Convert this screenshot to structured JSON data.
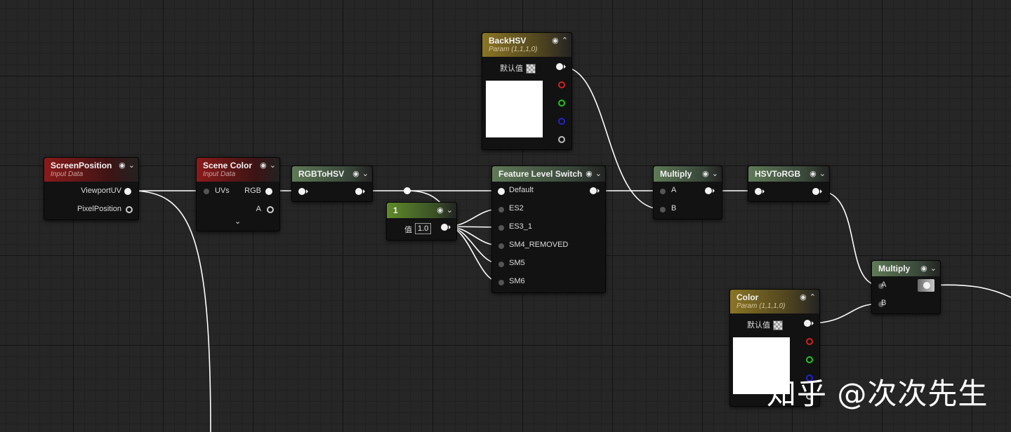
{
  "nodes": {
    "screen_position": {
      "title": "ScreenPosition",
      "subtitle": "Input Data",
      "outputs": [
        "ViewportUV",
        "PixelPosition"
      ]
    },
    "scene_color": {
      "title": "Scene Color",
      "subtitle": "Input Data",
      "input": "UVs",
      "outputs": [
        "RGB",
        "A"
      ],
      "expand_glyph": "⌄"
    },
    "rgb_to_hsv": {
      "title": "RGBToHSV"
    },
    "constant": {
      "title": "1",
      "value_label": "值",
      "value": "1.0"
    },
    "feature_level_switch": {
      "title": "Feature Level Switch",
      "inputs": [
        "Default",
        "ES2",
        "ES3_1",
        "SM4_REMOVED",
        "SM5",
        "SM6"
      ]
    },
    "back_hsv": {
      "title": "BackHSV",
      "subtitle": "Param (1,1,1,0)",
      "default_label": "默认值"
    },
    "multiply_1": {
      "title": "Multiply",
      "inputs": [
        "A",
        "B"
      ]
    },
    "hsv_to_rgb": {
      "title": "HSVToRGB"
    },
    "multiply_2": {
      "title": "Multiply",
      "inputs": [
        "A",
        "B"
      ]
    },
    "color": {
      "title": "Color",
      "subtitle": "Param (1,1,1,0)",
      "default_label": "默认值"
    }
  },
  "header_icons": {
    "preview": "◉",
    "collapse": "⌄",
    "expand": "⌃"
  },
  "watermark": "知乎 @次次先生",
  "colors": {
    "input_header": "#8a1a1a",
    "function_header": "#5f7a57",
    "constant_header": "#5f8a2a",
    "param_header": "#8a7524",
    "wire": "#ffffff",
    "background": "#262626"
  }
}
